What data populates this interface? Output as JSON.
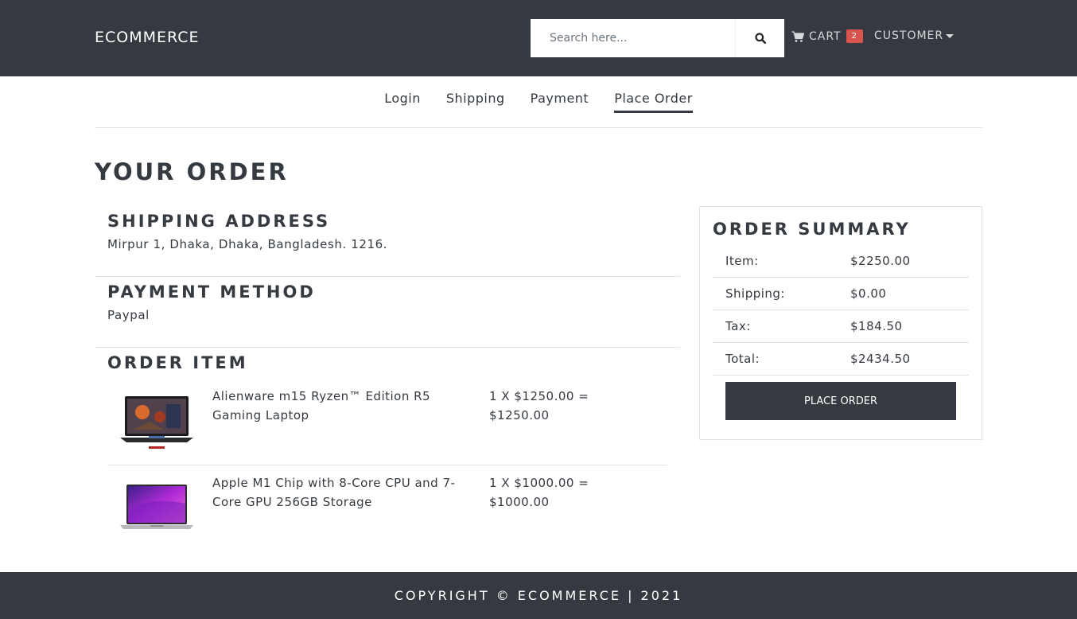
{
  "header": {
    "brand": "ECOMMERCE",
    "search_placeholder": "Search here...",
    "search_icon": "search-icon",
    "cart_label": "CART",
    "cart_count": "2",
    "customer_label": "CUSTOMER"
  },
  "steps": [
    {
      "label": "Login",
      "active": false
    },
    {
      "label": "Shipping",
      "active": false
    },
    {
      "label": "Payment",
      "active": false
    },
    {
      "label": "Place Order",
      "active": true
    }
  ],
  "page": {
    "title": "YOUR ORDER",
    "shipping": {
      "heading": "SHIPPING ADDRESS",
      "address": "Mirpur 1, Dhaka, Dhaka, Bangladesh. 1216."
    },
    "payment": {
      "heading": "PAYMENT METHOD",
      "method": "Paypal"
    },
    "items_heading": "ORDER ITEM",
    "items": [
      {
        "name": "Alienware m15 Ryzen™ Edition R5 Gaming Laptop",
        "price_line": "1 X $1250.00 = $1250.00",
        "image": "laptop-dark"
      },
      {
        "name": "Apple M1 Chip with 8-Core CPU and 7-Core GPU 256GB Storage",
        "price_line": "1 X $1000.00 = $1000.00",
        "image": "macbook"
      }
    ]
  },
  "summary": {
    "title": "ORDER SUMMARY",
    "rows": [
      {
        "label": "Item:",
        "value": "$2250.00"
      },
      {
        "label": "Shipping:",
        "value": "$0.00"
      },
      {
        "label": "Tax:",
        "value": "$184.50"
      },
      {
        "label": "Total:",
        "value": "$2434.50"
      }
    ],
    "button": "PLACE ORDER"
  },
  "footer": {
    "text": "COPYRIGHT © ECOMMERCE | 2021"
  },
  "colors": {
    "dark": "#343a40",
    "badge": "#d9534f",
    "border": "#dee2e6"
  }
}
